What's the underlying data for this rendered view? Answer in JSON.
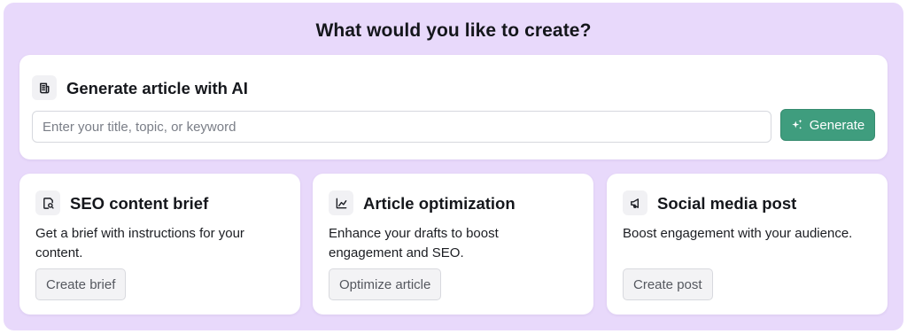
{
  "page_title": "What would you like to create?",
  "generate_card": {
    "icon": "article-icon",
    "title": "Generate article with AI",
    "input": {
      "value": "",
      "placeholder": "Enter your title, topic, or keyword"
    },
    "button": {
      "icon": "sparkles-icon",
      "label": "Generate"
    }
  },
  "cards": [
    {
      "icon": "document-search-icon",
      "title": "SEO content brief",
      "description": "Get a brief with instructions for your content.",
      "button_label": "Create brief"
    },
    {
      "icon": "line-chart-icon",
      "title": "Article optimization",
      "description": "Enhance your drafts to boost engagement and SEO.",
      "button_label": "Optimize article"
    },
    {
      "icon": "megaphone-icon",
      "title": "Social media post",
      "description": "Boost engagement with your audience.",
      "button_label": "Create post"
    }
  ],
  "colors": {
    "panel_background": "#e8d9fb",
    "card_background": "#ffffff",
    "primary_button": "#3f9d7e",
    "secondary_button": "#f3f3f5",
    "icon_background": "#f1f1f4"
  }
}
